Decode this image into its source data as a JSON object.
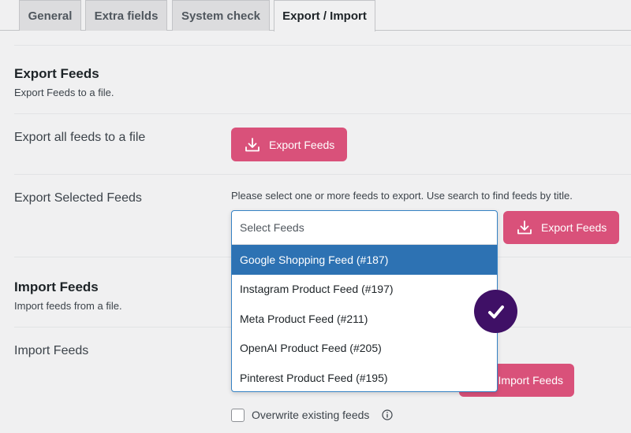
{
  "tabs": [
    {
      "label": "General"
    },
    {
      "label": "Extra fields"
    },
    {
      "label": "System check"
    },
    {
      "label": "Export / Import"
    }
  ],
  "export_section": {
    "title": "Export Feeds",
    "description": "Export Feeds to a file."
  },
  "export_all": {
    "label": "Export all feeds to a file",
    "button_label": "Export Feeds"
  },
  "export_selected": {
    "label": "Export Selected Feeds",
    "hint": "Please select one or more feeds to export. Use search to find feeds by title.",
    "select_placeholder": "Select Feeds",
    "options": [
      {
        "label": "Google Shopping Feed (#187)"
      },
      {
        "label": "Instagram Product Feed (#197)"
      },
      {
        "label": "Meta Product Feed (#211)"
      },
      {
        "label": "OpenAI Product Feed (#205)"
      },
      {
        "label": "Pinterest Product Feed (#195)"
      }
    ],
    "button_label": "Export Feeds"
  },
  "import_section": {
    "title": "Import Feeds",
    "description": "Import feeds from a file."
  },
  "import_row": {
    "label": "Import Feeds",
    "button_label": "Import Feeds",
    "overwrite_label": "Overwrite existing feeds"
  },
  "colors": {
    "accent": "#d9517a",
    "highlight": "#2d72b3",
    "badge": "#3f1066"
  }
}
